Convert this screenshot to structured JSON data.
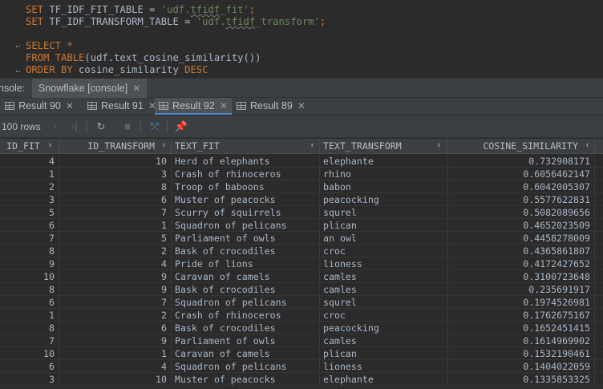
{
  "editor": {
    "line1": {
      "kw": "SET",
      "name": "TF_IDF_FIT_TABLE",
      "eq": " = ",
      "str_a": "'udf.",
      "str_b": "tfidf",
      "str_c": "_fit'",
      "semi": ";"
    },
    "line2": {
      "kw": "SET",
      "name": "TF_IDF_TRANSFORM_TABLE",
      "eq": " = ",
      "str_a": "'udf.",
      "str_b": "tfidf",
      "str_c": "_transform'",
      "semi": ";"
    },
    "line4": {
      "kw": "SELECT",
      "rest": "*"
    },
    "line5": {
      "kw1": "FROM",
      "kw2": "TABLE",
      "rest": "(udf.text_cosine_similarity())"
    },
    "line6": {
      "kw1": "ORDER BY",
      "rest": " cosine_similarity ",
      "kw2": "DESC"
    }
  },
  "console_tabs": [
    {
      "label": "nsole:"
    },
    {
      "label": "Snowflake [console]"
    }
  ],
  "result_tabs": [
    {
      "label": "Result 90"
    },
    {
      "label": "Result 91"
    },
    {
      "label": "Result 92"
    },
    {
      "label": "Result 89"
    }
  ],
  "toolbar": {
    "rows_label": "100 rows"
  },
  "columns": [
    "ID_FIT",
    "ID_TRANSFORM",
    "TEXT_FIT",
    "TEXT_TRANSFORM",
    "COSINE_SIMILARITY"
  ],
  "rows": [
    [
      "4",
      "10",
      "Herd of elephants",
      "elephante",
      "0.732908171"
    ],
    [
      "1",
      "3",
      "Crash of rhinoceros",
      "rhino",
      "0.6056462147"
    ],
    [
      "2",
      "8",
      "Troop of baboons",
      "babon",
      "0.6042005307"
    ],
    [
      "3",
      "6",
      "Muster of peacocks",
      "peacocking",
      "0.5577622831"
    ],
    [
      "5",
      "7",
      "Scurry of squirrels",
      "squrel",
      "0.5082089656"
    ],
    [
      "6",
      "1",
      "Squadron of pelicans",
      "plican",
      "0.4652023509"
    ],
    [
      "7",
      "5",
      "Parliament of owls",
      "an owl",
      "0.4458278009"
    ],
    [
      "8",
      "2",
      "Bask of crocodiles",
      "croc",
      "0.4365861807"
    ],
    [
      "9",
      "4",
      "Pride of lions",
      "lioness",
      "0.4172427652"
    ],
    [
      "10",
      "9",
      "Caravan of camels",
      "camles",
      "0.3100723648"
    ],
    [
      "8",
      "9",
      "Bask of crocodiles",
      "camles",
      "0.235691917"
    ],
    [
      "6",
      "7",
      "Squadron of pelicans",
      "squrel",
      "0.1974526981"
    ],
    [
      "1",
      "2",
      "Crash of rhinoceros",
      "croc",
      "0.1762675167"
    ],
    [
      "8",
      "6",
      "Bask of crocodiles",
      "peacocking",
      "0.1652451415"
    ],
    [
      "7",
      "9",
      "Parliament of owls",
      "camles",
      "0.1614969902"
    ],
    [
      "10",
      "1",
      "Caravan of camels",
      "plican",
      "0.1532190461"
    ],
    [
      "6",
      "4",
      "Squadron of pelicans",
      "lioness",
      "0.1404022059"
    ],
    [
      "3",
      "10",
      "Muster of peacocks",
      "elephante",
      "0.1335853325"
    ]
  ]
}
